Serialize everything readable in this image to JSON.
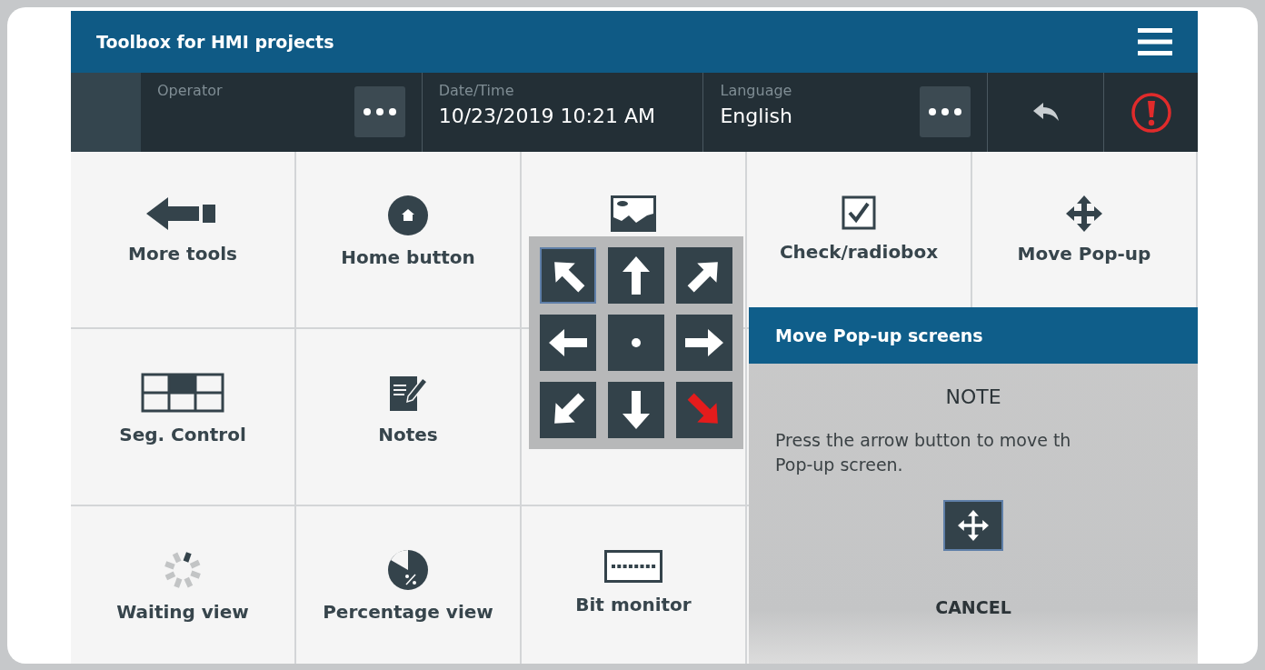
{
  "title_bar": {
    "title": "Toolbox for HMI projects"
  },
  "header": {
    "fields": [
      {
        "label": "Operator",
        "has_menu": true
      },
      {
        "label": "Date/Time",
        "value": "10/23/2019 10:21 AM",
        "has_menu": false
      },
      {
        "label": "Language",
        "value": "English",
        "has_menu": true
      }
    ]
  },
  "tile_rows": [
    [
      {
        "label": "More tools"
      },
      {
        "label": "Home button"
      },
      {},
      {
        "label": "Check/radiobox"
      },
      {
        "label": "Move Pop-up"
      }
    ],
    [
      {
        "label": "Seg. Control"
      },
      {
        "label": "Notes"
      }
    ],
    [
      {
        "label": "Waiting view"
      },
      {
        "label": "Percentage view"
      },
      {
        "label": "Bit monitor"
      }
    ]
  ],
  "arrow_pad": [
    {
      "focused": true,
      "active": false
    },
    {
      "focused": false,
      "active": false
    },
    {
      "focused": false,
      "active": false
    },
    {
      "focused": false,
      "active": false
    },
    {
      "focused": false,
      "active": false
    },
    {
      "focused": false,
      "active": false
    },
    {
      "focused": false,
      "active": false
    },
    {
      "focused": false,
      "active": false
    },
    {
      "focused": false,
      "active": true
    }
  ],
  "popup": {
    "title": "Move Pop-up screens",
    "heading": "NOTE",
    "message": "Press the arrow button to move th\nPop-up screen.",
    "cancel": "CANCEL"
  }
}
